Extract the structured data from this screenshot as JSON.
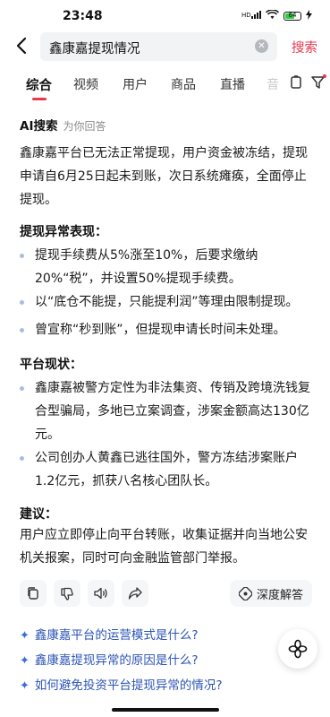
{
  "status": {
    "time": "23:48",
    "battery": "64",
    "battery_level": 0.64
  },
  "header": {
    "query": "鑫康嘉提现情况",
    "search_label": "搜索"
  },
  "tabs": [
    {
      "label": "综合"
    },
    {
      "label": "视频"
    },
    {
      "label": "用户"
    },
    {
      "label": "商品"
    },
    {
      "label": "直播"
    },
    {
      "label": "音"
    }
  ],
  "ai": {
    "title": "AI搜索",
    "subtitle": "为你回答",
    "intro": "鑫康嘉平台已无法正常提现，用户资金被冻结，提现申请自6月25日起未到账，次日系统瘫痪，全面停止提现。",
    "section1_title": "提现异常表现：",
    "section1_items": [
      "提现手续费从5%涨至10%，后要求缴纳20%“税”，并设置50%提现手续费。",
      "以“底仓不能提，只能提利润”等理由限制提现。",
      "曾宣称“秒到账”，但提现申请长时间未处理。"
    ],
    "section2_title": "平台现状：",
    "section2_items": [
      "鑫康嘉被警方定性为非法集资、传销及跨境洗钱复合型骗局，多地已立案调查，涉案金额高达130亿元。",
      "公司创办人黄鑫已逃往国外，警方冻结涉案账户1.2亿元，抓获八名核心团队长。"
    ],
    "advice_title": "建议：",
    "advice_text": "用户应立即停止向平台转账，收集证据并向当地公安机关报案，同时可向金融监管部门举报。",
    "deep_label": "深度解答"
  },
  "suggestions": [
    "鑫康嘉平台的运营模式是什么?",
    "鑫康嘉提现异常的原因是什么?",
    "如何避免投资平台提现异常的情况?"
  ]
}
